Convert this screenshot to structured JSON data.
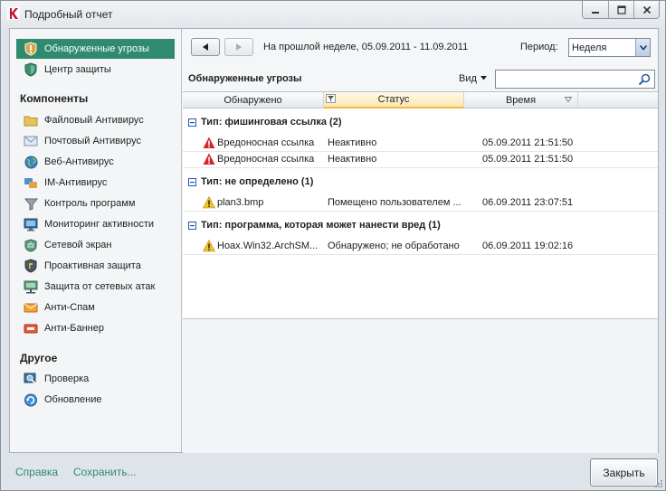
{
  "window": {
    "title": "Подробный отчет",
    "accent_color": "#2f8a6e",
    "controls": [
      "minimize-icon",
      "maximize-icon",
      "close-icon"
    ]
  },
  "sidebar": {
    "top_items": [
      {
        "label": "Обнаруженные угрозы",
        "icon": "shield-alert-icon",
        "active": true
      },
      {
        "label": "Центр защиты",
        "icon": "shield-icon",
        "active": false
      }
    ],
    "components_heading": "Компоненты",
    "components": [
      {
        "label": "Файловый Антивирус",
        "icon": "folder-icon"
      },
      {
        "label": "Почтовый Антивирус",
        "icon": "mail-icon"
      },
      {
        "label": "Веб-Антивирус",
        "icon": "globe-icon"
      },
      {
        "label": "IM-Антивирус",
        "icon": "chat-icon"
      },
      {
        "label": "Контроль программ",
        "icon": "filter-icon"
      },
      {
        "label": "Мониторинг активности",
        "icon": "monitor-icon"
      },
      {
        "label": "Сетевой экран",
        "icon": "firewall-icon"
      },
      {
        "label": "Проактивная защита",
        "icon": "shield-icon"
      },
      {
        "label": "Защита от сетевых атак",
        "icon": "network-icon"
      },
      {
        "label": "Анти-Спам",
        "icon": "antispam-icon"
      },
      {
        "label": "Анти-Баннер",
        "icon": "banner-icon"
      }
    ],
    "other_heading": "Другое",
    "other": [
      {
        "label": "Проверка",
        "icon": "scan-icon"
      },
      {
        "label": "Обновление",
        "icon": "update-icon"
      }
    ]
  },
  "toolbar": {
    "back_icon": "arrow-left-icon",
    "forward_icon": "arrow-right-icon",
    "range_text": "На прошлой неделе, 05.09.2011 - 11.09.2011",
    "period_label": "Период:",
    "period_value": "Неделя"
  },
  "threats": {
    "title": "Обнаруженные угрозы",
    "view_label": "Вид",
    "search_placeholder": "",
    "columns": [
      "Обнаружено",
      "Статус",
      "Время"
    ],
    "sorted_column": "Статус",
    "groups": [
      {
        "label": "Тип: фишинговая ссылка (2)",
        "rows": [
          {
            "icon": "error-icon",
            "detected": "Вредоносная ссылка",
            "status": "Неактивно",
            "time": "05.09.2011 21:51:50"
          },
          {
            "icon": "error-icon",
            "detected": "Вредоносная ссылка",
            "status": "Неактивно",
            "time": "05.09.2011 21:51:50"
          }
        ]
      },
      {
        "label": "Тип: не определено (1)",
        "rows": [
          {
            "icon": "warning-icon",
            "detected": "plan3.bmp",
            "status": "Помещено пользователем ...",
            "time": "06.09.2011 23:07:51"
          }
        ]
      },
      {
        "label": "Тип: программа, которая может нанести вред (1)",
        "rows": [
          {
            "icon": "warning-icon",
            "detected": "Hoax.Win32.ArchSM...",
            "status": "Обнаружено; не обработано",
            "time": "06.09.2011 19:02:16"
          }
        ]
      }
    ]
  },
  "footer": {
    "help_link": "Справка",
    "save_link": "Сохранить...",
    "close_button": "Закрыть"
  }
}
